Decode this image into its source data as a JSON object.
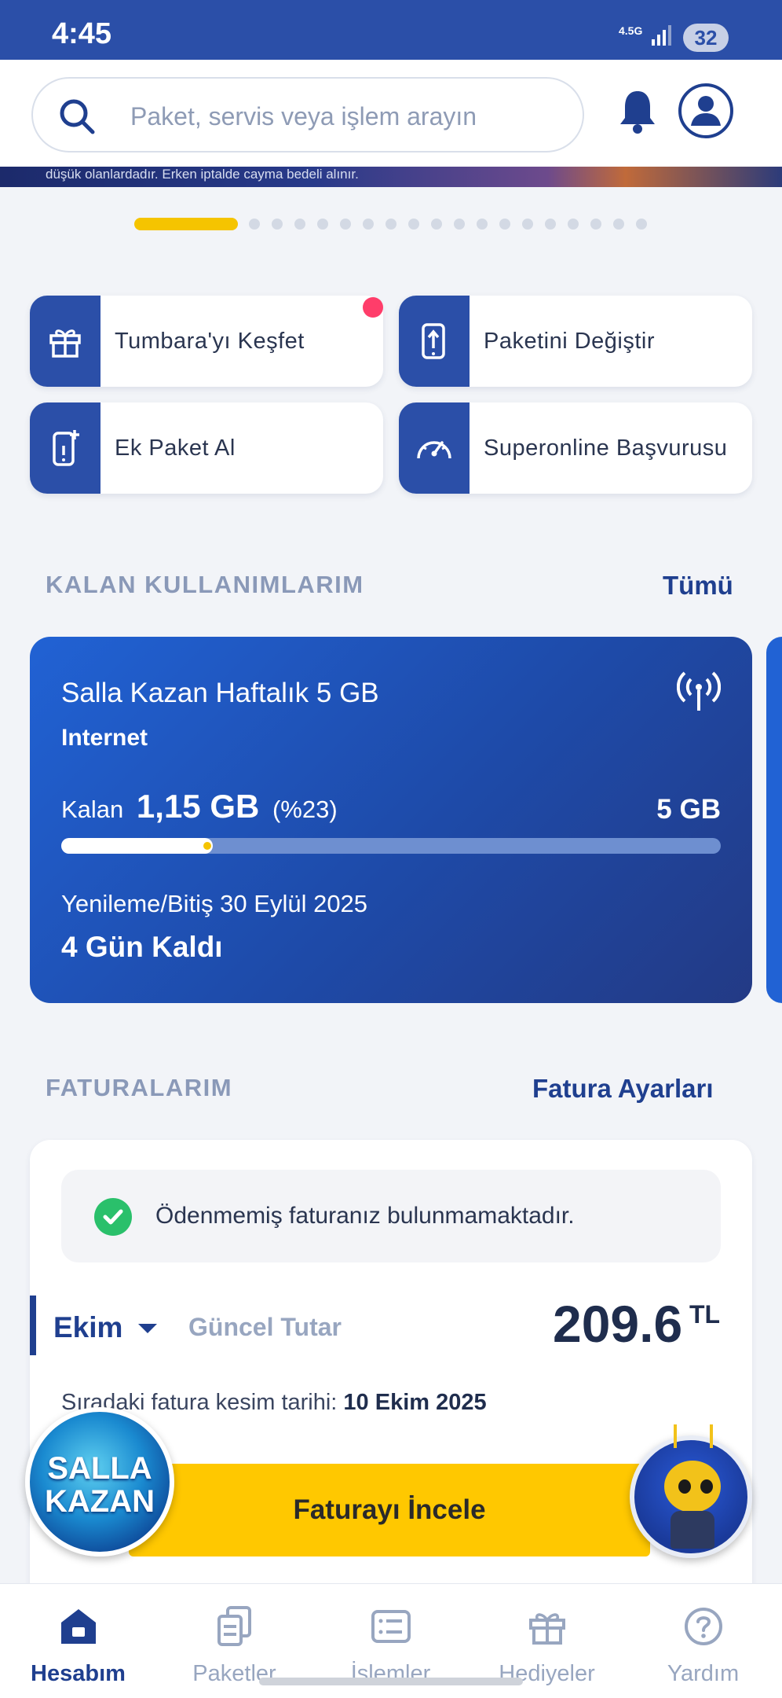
{
  "status_bar": {
    "time": "4:45",
    "network": "4.5G",
    "battery": "32"
  },
  "search": {
    "placeholder": "Paket, servis veya işlem arayın"
  },
  "banner": {
    "text": "düşük olanlardadır. Erken iptalde cayma bedeli alınır."
  },
  "carousel": {
    "total_slides": 19,
    "active_index": 0
  },
  "quick_actions": [
    {
      "label": "Tumbara'yı Keşfet",
      "icon": "gift-icon",
      "has_badge": true
    },
    {
      "label": "Paketini Değiştir",
      "icon": "phone-upgrade-icon",
      "has_badge": false
    },
    {
      "label": "Ek Paket Al",
      "icon": "phone-add-icon",
      "has_badge": false
    },
    {
      "label": "Superonline Başvurusu",
      "icon": "speedometer-icon",
      "has_badge": false
    }
  ],
  "usage_section": {
    "title": "KALAN KULLANIMLARIM",
    "link": "Tümü",
    "card": {
      "name": "Salla Kazan Haftalık 5 GB",
      "type": "Internet",
      "remaining_label": "Kalan",
      "remaining_value": "1,15 GB",
      "remaining_percent_text": "(%23)",
      "remaining_fraction": 0.23,
      "total": "5 GB",
      "renewal_text": "Yenileme/Bitiş 30 Eylül 2025",
      "days_left": "4 Gün Kaldı"
    }
  },
  "bills_section": {
    "title": "FATURALARIM",
    "link": "Fatura Ayarları",
    "notice": "Ödenmemiş faturanız bulunmamaktadır.",
    "month": "Ekim",
    "current_label": "Güncel Tutar",
    "amount": "209.6",
    "currency": "TL",
    "next_cut_label": "Sıradaki fatura kesim tarihi:",
    "next_cut_date": "10 Ekim 2025",
    "cta": "Faturayı İncele"
  },
  "floating": {
    "salla_line1": "SALLA",
    "salla_line2": "KAZAN"
  },
  "tabs": [
    {
      "label": "Hesabım",
      "icon": "home-icon",
      "active": true
    },
    {
      "label": "Paketler",
      "icon": "packages-icon",
      "active": false
    },
    {
      "label": "İşlemler",
      "icon": "list-icon",
      "active": false
    },
    {
      "label": "Hediyeler",
      "icon": "gift-icon",
      "active": false
    },
    {
      "label": "Yardım",
      "icon": "help-icon",
      "active": false
    }
  ],
  "colors": {
    "brand_blue": "#2b4fa8",
    "accent_yellow": "#ffc800",
    "badge_red": "#ff3d6a",
    "success_green": "#2ac06b"
  }
}
